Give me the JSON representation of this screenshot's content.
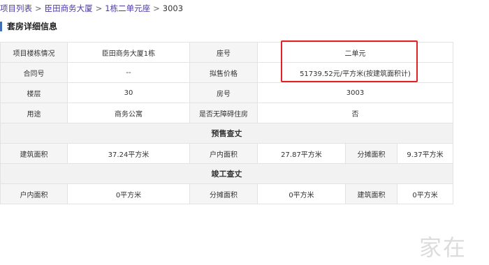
{
  "breadcrumb": {
    "items": [
      "项目列表",
      "臣田商务大厦",
      "1栋二单元座",
      "3003"
    ],
    "separator": ">"
  },
  "section_title": "套房详细信息",
  "rows": [
    {
      "label1": "项目楼栋情况",
      "value1": "臣田商务大厦1栋",
      "label2": "座号",
      "value2": "二单元"
    },
    {
      "label1": "合同号",
      "value1": "--",
      "label2": "拟售价格",
      "value2": "51739.52元/平方米(按建筑面积计)"
    },
    {
      "label1": "楼层",
      "value1": "30",
      "label2": "房号",
      "value2": "3003"
    },
    {
      "label1": "用途",
      "value1": "商务公寓",
      "label2": "是否无障碍住房",
      "value2": "否"
    }
  ],
  "presale": {
    "title": "预售查丈",
    "c1_label": "建筑面积",
    "c1_value": "37.24平方米",
    "c2_label": "户内面积",
    "c2_value": "27.87平方米",
    "c3_label": "分摊面积",
    "c3_value": "9.37平方米"
  },
  "completion": {
    "title": "竣工查丈",
    "c1_label": "户内面积",
    "c1_value": "0平方米",
    "c2_label": "分摊面积",
    "c2_value": "0平方米",
    "c3_label": "建筑面积",
    "c3_value": "0平方米"
  },
  "watermark": "家在",
  "colors": {
    "link": "#4a3aa8",
    "title_bar": "#3f6fb5",
    "highlight": "#e02222",
    "label_bg": "#f5f5f5",
    "section_bg": "#f2f2f2"
  }
}
